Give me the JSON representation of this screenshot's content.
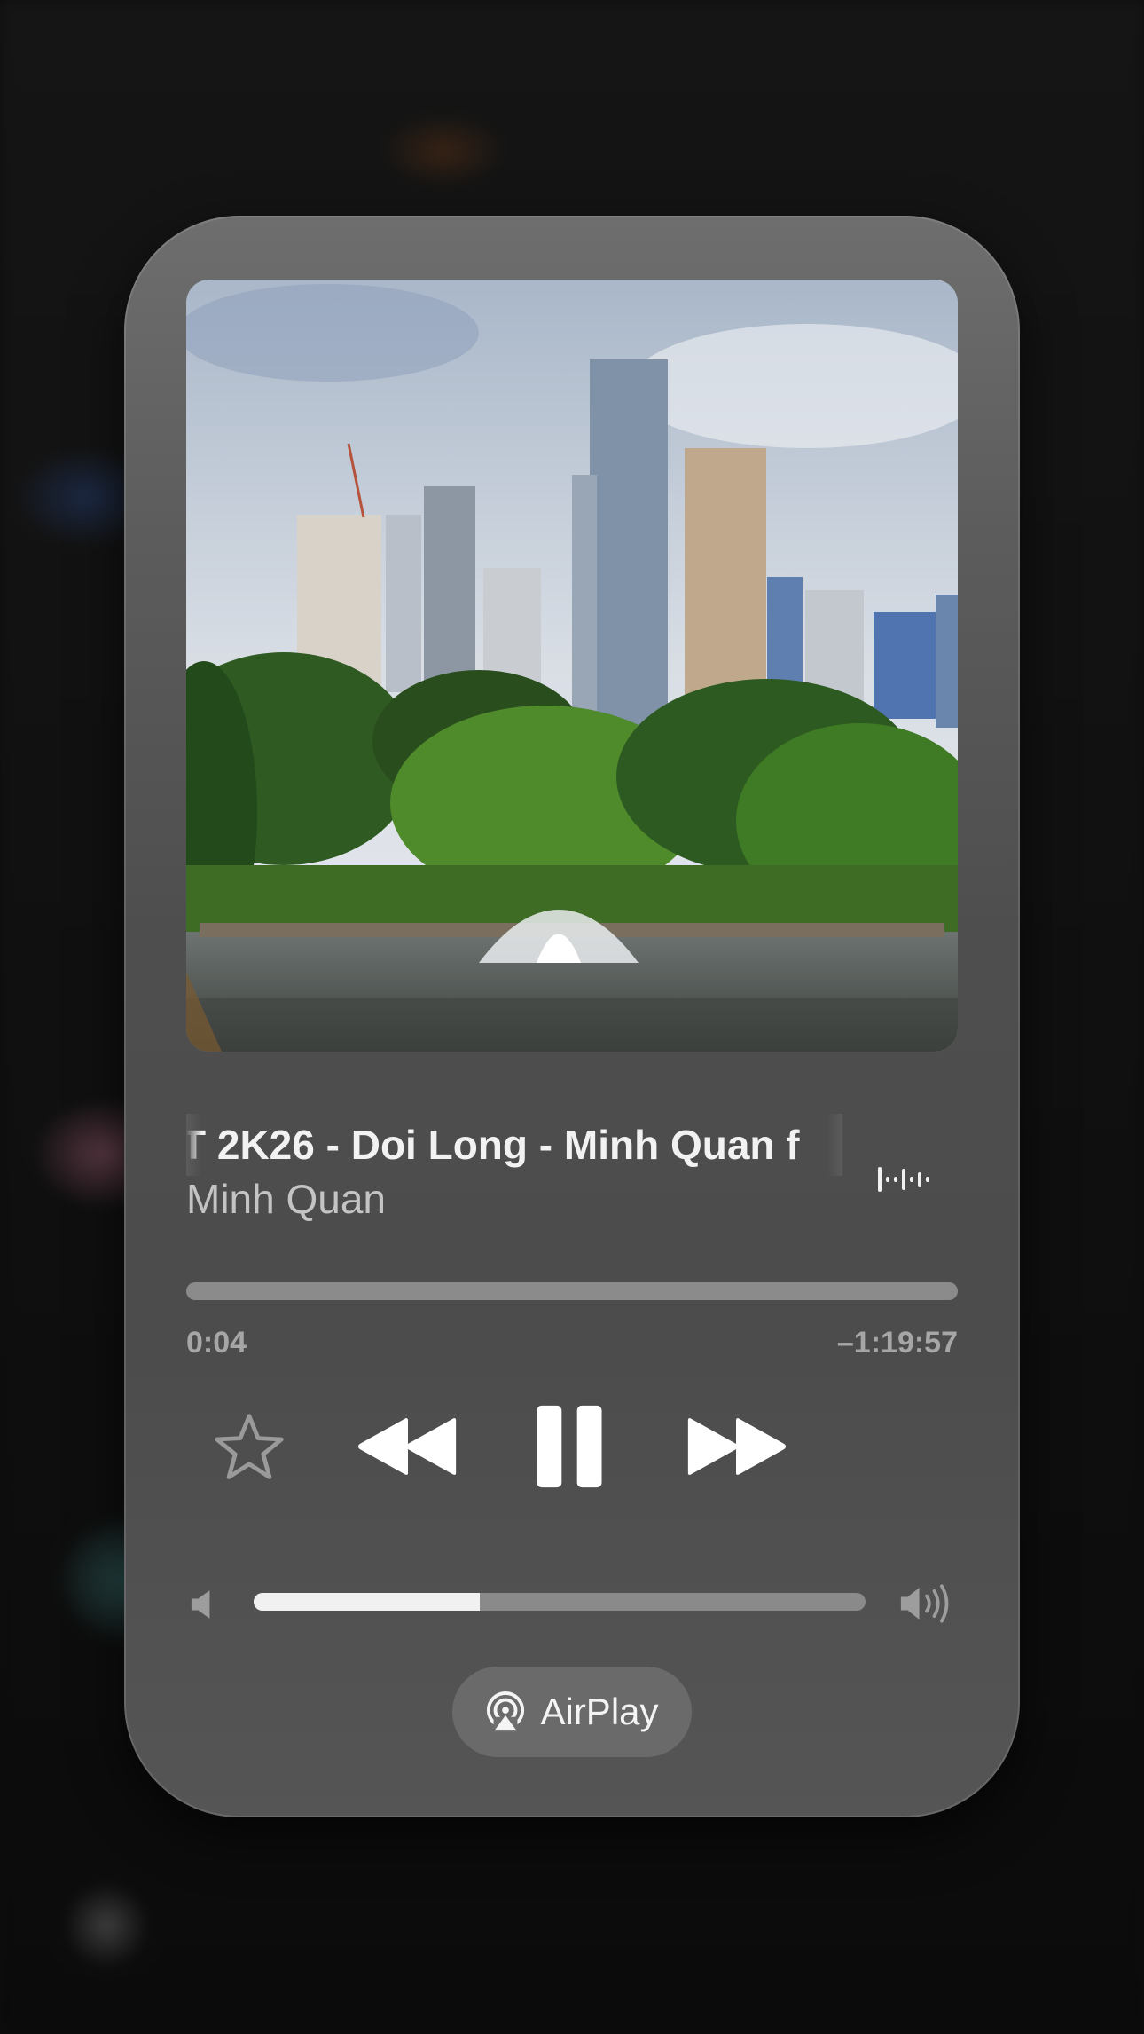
{
  "now_playing": {
    "title": "T 2K26 - Doi Long - Minh Quan f",
    "artist": "Minh Quan",
    "time_elapsed": "0:04",
    "time_remaining": "–1:19:57",
    "progress": 0.0,
    "volume": 0.37
  },
  "controls": {
    "favorite_icon": "star-outline-icon",
    "rewind_icon": "rewind-icon",
    "play_pause_icon": "pause-icon",
    "forward_icon": "fast-forward-icon",
    "volume_low_icon": "speaker-low-icon",
    "volume_high_icon": "speaker-high-icon",
    "waveform_icon": "waveform-icon"
  },
  "airplay": {
    "label": "AirPlay",
    "icon": "airplay-icon"
  },
  "colors": {
    "card": "#5a5a5a",
    "text_primary": "#f2f2f2",
    "text_secondary": "#c4c4c4",
    "track": "#8b8b8b",
    "volume_fill": "#f1f1f1"
  }
}
